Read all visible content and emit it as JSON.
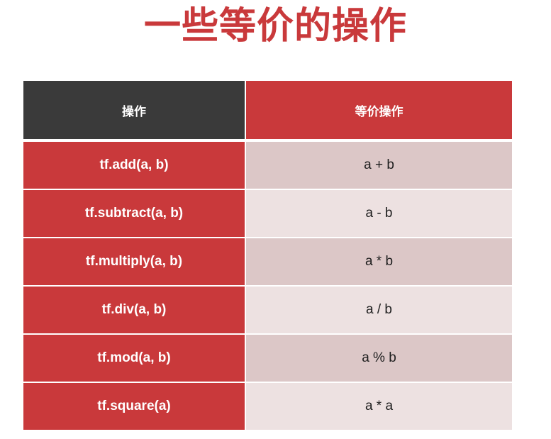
{
  "title": "一些等价的操作",
  "colors": {
    "accent": "#c9393b",
    "header_dark": "#3a3a3a",
    "row_shade_a": "#dcc7c7",
    "row_shade_b": "#ede1e1"
  },
  "table": {
    "headers": [
      "操作",
      "等价操作"
    ],
    "rows": [
      {
        "op": "tf.add(a, b)",
        "equiv": "a + b"
      },
      {
        "op": "tf.subtract(a, b)",
        "equiv": "a - b"
      },
      {
        "op": "tf.multiply(a, b)",
        "equiv": "a * b"
      },
      {
        "op": "tf.div(a, b)",
        "equiv": "a / b"
      },
      {
        "op": "tf.mod(a, b)",
        "equiv": "a % b"
      },
      {
        "op": "tf.square(a)",
        "equiv": "a * a"
      }
    ]
  }
}
